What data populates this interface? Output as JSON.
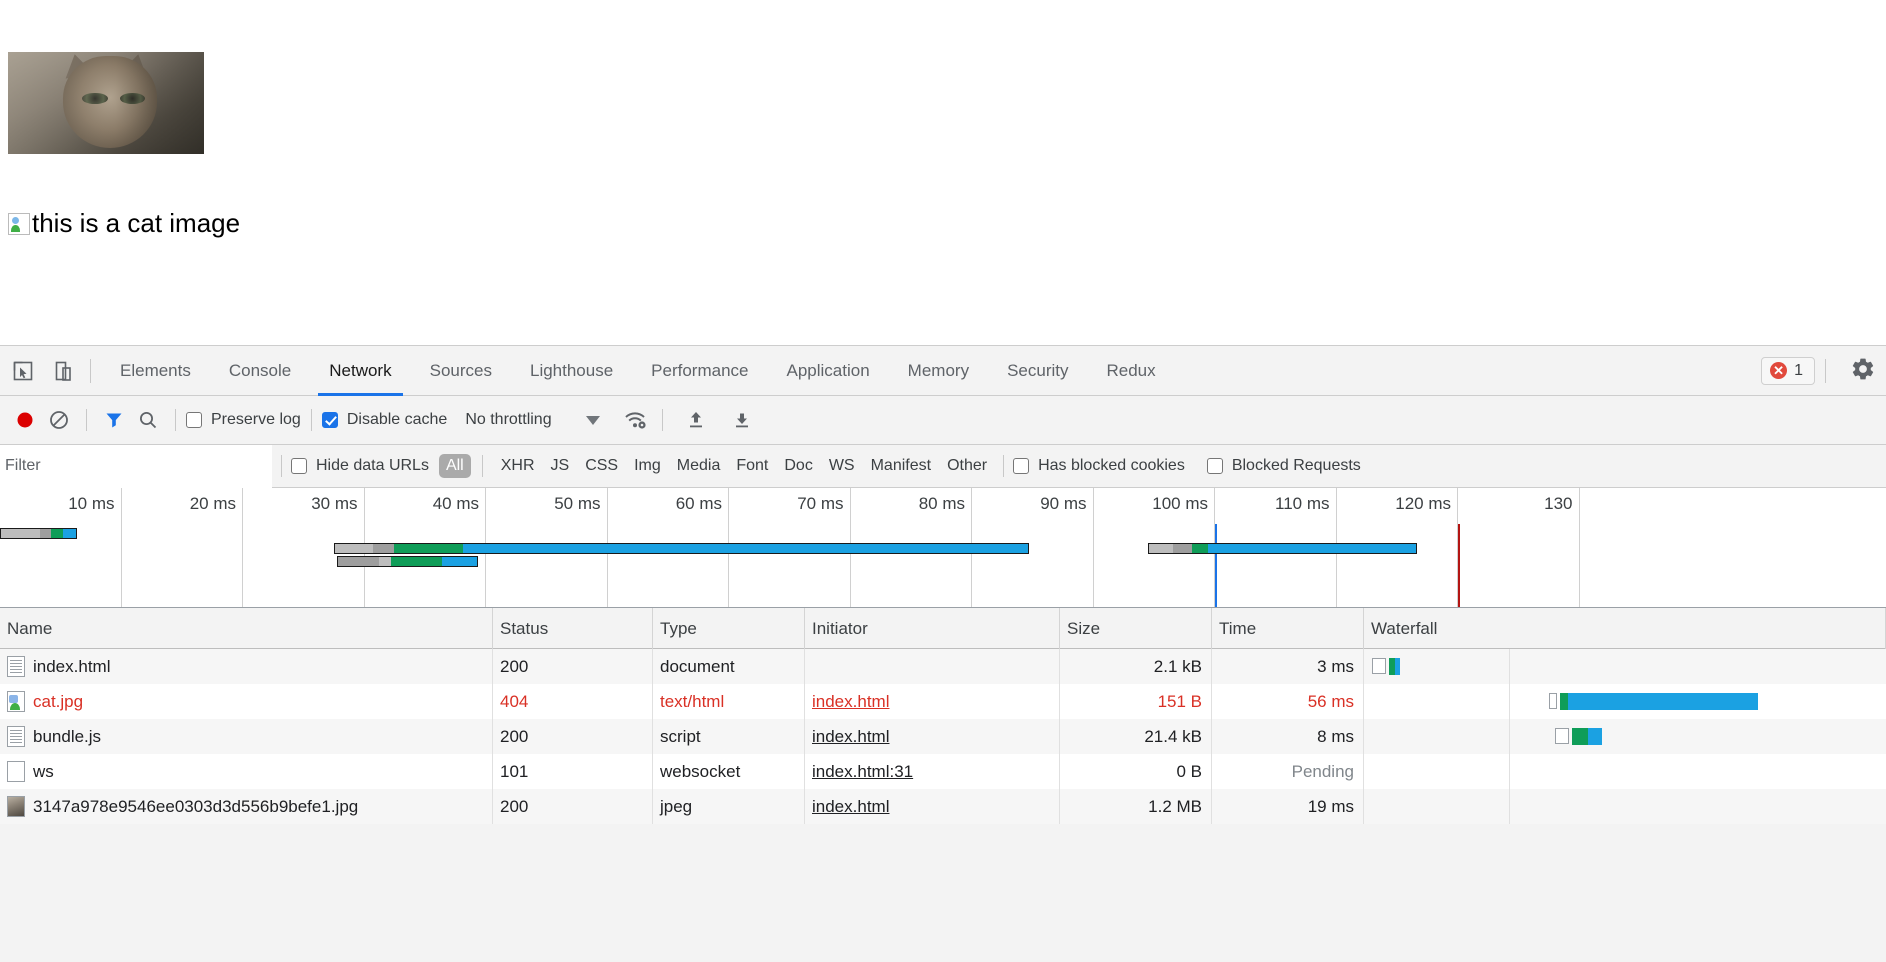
{
  "page": {
    "image_alt_text": "this is a cat image",
    "broken_image_icon": "broken-image-icon",
    "photo_name": "cat-photo"
  },
  "devtools": {
    "tabs": [
      {
        "label": "Elements",
        "active": false
      },
      {
        "label": "Console",
        "active": false
      },
      {
        "label": "Network",
        "active": true
      },
      {
        "label": "Sources",
        "active": false
      },
      {
        "label": "Lighthouse",
        "active": false
      },
      {
        "label": "Performance",
        "active": false
      },
      {
        "label": "Application",
        "active": false
      },
      {
        "label": "Memory",
        "active": false
      },
      {
        "label": "Security",
        "active": false
      },
      {
        "label": "Redux",
        "active": false
      }
    ],
    "left_icons": [
      {
        "name": "inspect-element-icon"
      },
      {
        "name": "device-toolbar-icon"
      }
    ],
    "error_badge": {
      "count": "1",
      "icon": "error-circle-icon"
    },
    "settings_icon": "gear-icon",
    "accent_color": "#1a73e8",
    "error_color": "#d93025"
  },
  "toolbar": {
    "record_button": "record-icon",
    "clear_button": "clear-icon",
    "filter_button": "funnel-icon",
    "search_button": "search-icon",
    "preserve_log": {
      "label": "Preserve log",
      "checked": false
    },
    "disable_cache": {
      "label": "Disable cache",
      "checked": true
    },
    "throttling": {
      "value": "No throttling",
      "caret": "chevron-down-icon"
    },
    "network_conditions_icon": "wifi-settings-icon",
    "import_har_icon": "upload-arrow-icon",
    "export_har_icon": "download-arrow-icon"
  },
  "filterbar": {
    "filter_placeholder": "Filter",
    "filter_value": "",
    "hide_data_urls": {
      "label": "Hide data URLs",
      "checked": false
    },
    "types": [
      {
        "label": "All",
        "selected": true
      },
      {
        "label": "XHR",
        "selected": false
      },
      {
        "label": "JS",
        "selected": false
      },
      {
        "label": "CSS",
        "selected": false
      },
      {
        "label": "Img",
        "selected": false
      },
      {
        "label": "Media",
        "selected": false
      },
      {
        "label": "Font",
        "selected": false
      },
      {
        "label": "Doc",
        "selected": false
      },
      {
        "label": "WS",
        "selected": false
      },
      {
        "label": "Manifest",
        "selected": false
      },
      {
        "label": "Other",
        "selected": false
      }
    ],
    "has_blocked_cookies": {
      "label": "Has blocked cookies",
      "checked": false
    },
    "blocked_requests": {
      "label": "Blocked Requests",
      "checked": false
    }
  },
  "overview": {
    "ticks": [
      "10 ms",
      "20 ms",
      "30 ms",
      "40 ms",
      "50 ms",
      "60 ms",
      "70 ms",
      "80 ms",
      "90 ms",
      "100 ms",
      "110 ms",
      "120 ms",
      "130"
    ],
    "dom_content_loaded_ms": 100,
    "load_event_ms": 120,
    "dom_content_loaded_color": "#1a73e8",
    "load_event_color": "#b31412",
    "bars": [
      {
        "name": "index.html",
        "start_ms": 0,
        "end_ms": 6.2,
        "segments": [
          {
            "phase": "stalled",
            "frac": 0.52,
            "color": "#bdbdbd"
          },
          {
            "phase": "ttfb",
            "frac": 0.14,
            "color": "#9e9e9e"
          },
          {
            "phase": "waiting",
            "frac": 0.16,
            "color": "#0f9d58"
          },
          {
            "phase": "download",
            "frac": 0.18,
            "color": "#1ba1e2"
          }
        ]
      },
      {
        "name": "cat.jpg",
        "start_ms": 27.5,
        "end_ms": 84.5,
        "segments": [
          {
            "phase": "stalled",
            "frac": 0.055,
            "color": "#bdbdbd"
          },
          {
            "phase": "ttfb",
            "frac": 0.03,
            "color": "#9e9e9e"
          },
          {
            "phase": "waiting",
            "frac": 0.1,
            "color": "#0f9d58"
          },
          {
            "phase": "download",
            "frac": 0.815,
            "color": "#1ba1e2"
          }
        ]
      },
      {
        "name": "bundle.js",
        "start_ms": 27.7,
        "end_ms": 39.2,
        "segments": [
          {
            "phase": "stalled",
            "frac": 0.3,
            "color": "#9e9e9e"
          },
          {
            "phase": "ttfb",
            "frac": 0.08,
            "color": "#bdbdbd"
          },
          {
            "phase": "waiting",
            "frac": 0.37,
            "color": "#0f9d58"
          },
          {
            "phase": "download",
            "frac": 0.25,
            "color": "#1ba1e2"
          }
        ]
      },
      {
        "name": "3147a978e9546ee0303d3d556b9befe1.jpg",
        "start_ms": 94.5,
        "end_ms": 116.5,
        "segments": [
          {
            "phase": "stalled",
            "frac": 0.09,
            "color": "#bdbdbd"
          },
          {
            "phase": "ttfb",
            "frac": 0.07,
            "color": "#9e9e9e"
          },
          {
            "phase": "waiting",
            "frac": 0.06,
            "color": "#0f9d58"
          },
          {
            "phase": "download",
            "frac": 0.78,
            "color": "#1ba1e2"
          }
        ]
      }
    ]
  },
  "table": {
    "columns": [
      "Name",
      "Status",
      "Type",
      "Initiator",
      "Size",
      "Time",
      "Waterfall"
    ],
    "rows": [
      {
        "icon": "document-file-icon",
        "name": "index.html",
        "status": "200",
        "type": "document",
        "initiator": "",
        "size": "2.1 kB",
        "time": "3 ms",
        "error": false,
        "pending": false,
        "waterfall": {
          "start_pct": 1.5,
          "queue_w": 14,
          "segments": [
            {
              "color": "#0f9d58",
              "w": 6
            },
            {
              "color": "#1ba1e2",
              "w": 5
            }
          ]
        }
      },
      {
        "icon": "image-file-icon",
        "name": "cat.jpg",
        "status": "404",
        "type": "text/html",
        "initiator": "index.html",
        "size": "151 B",
        "time": "56 ms",
        "error": true,
        "pending": false,
        "waterfall": {
          "start_pct": 35.5,
          "queue_w": 8,
          "segments": [
            {
              "color": "#0f9d58",
              "w": 8
            },
            {
              "color": "#1ba1e2",
              "w": 190
            }
          ]
        }
      },
      {
        "icon": "document-file-icon",
        "name": "bundle.js",
        "status": "200",
        "type": "script",
        "initiator": "index.html",
        "size": "21.4 kB",
        "time": "8 ms",
        "error": false,
        "pending": false,
        "waterfall": {
          "start_pct": 36.5,
          "queue_w": 14,
          "segments": [
            {
              "color": "#0f9d58",
              "w": 16
            },
            {
              "color": "#1ba1e2",
              "w": 14
            }
          ]
        }
      },
      {
        "icon": "blank-file-icon",
        "name": "ws",
        "status": "101",
        "type": "websocket",
        "initiator": "index.html:31",
        "size": "0 B",
        "time": "Pending",
        "error": false,
        "pending": true,
        "waterfall": {
          "start_pct": 0,
          "queue_w": 0,
          "segments": []
        }
      },
      {
        "icon": "image-thumbnail-icon",
        "name": "3147a978e9546ee0303d3d556b9befe1.jpg",
        "status": "200",
        "type": "jpeg",
        "initiator": "index.html",
        "size": "1.2 MB",
        "time": "19 ms",
        "error": false,
        "pending": false,
        "waterfall": {
          "start_pct": 0,
          "queue_w": 0,
          "segments": []
        }
      }
    ]
  }
}
